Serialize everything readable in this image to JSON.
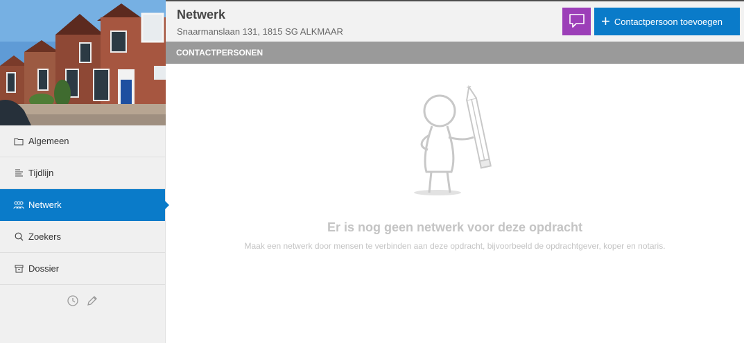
{
  "sidebar": {
    "items": [
      {
        "label": "Algemeen",
        "icon": "folder-icon",
        "active": false
      },
      {
        "label": "Tijdlijn",
        "icon": "timeline-icon",
        "active": false
      },
      {
        "label": "Netwerk",
        "icon": "people-icon",
        "active": true
      },
      {
        "label": "Zoekers",
        "icon": "search-icon",
        "active": false
      },
      {
        "label": "Dossier",
        "icon": "archive-icon",
        "active": false
      }
    ],
    "tools": [
      "clock-icon",
      "pencil-icon"
    ]
  },
  "header": {
    "title": "Netwerk",
    "subtitle": "Snaarmanslaan 131, 1815 SG ALKMAAR",
    "add_button_label": "Contactpersoon toevoegen"
  },
  "section": {
    "title": "CONTACTPERSONEN"
  },
  "empty_state": {
    "title": "Er is nog geen netwerk voor deze opdracht",
    "text": "Maak een netwerk door mensen te verbinden aan deze opdracht, bijvoorbeeld de opdrachtgever, koper en notaris."
  },
  "colors": {
    "primary": "#0a7bc9",
    "chat": "#9c3fb8",
    "section": "#9a9a9a"
  }
}
